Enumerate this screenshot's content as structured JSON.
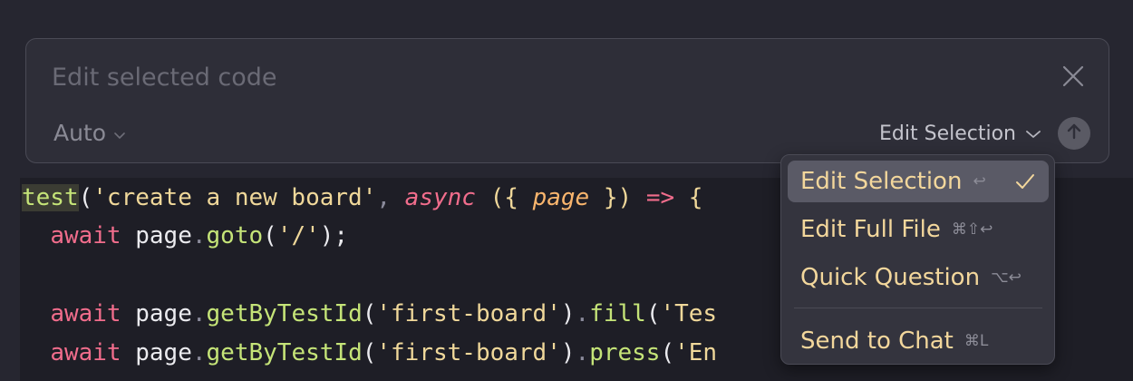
{
  "prompt": {
    "placeholder": "Edit selected code",
    "value": "",
    "model_label": "Auto",
    "mode_label": "Edit Selection"
  },
  "menu": {
    "items": [
      {
        "label": "Edit Selection",
        "shortcut": "↩",
        "selected": true
      },
      {
        "label": "Edit Full File",
        "shortcut": "⌘⇧↩",
        "selected": false
      },
      {
        "label": "Quick Question",
        "shortcut": "⌥↩",
        "selected": false
      },
      {
        "label": "Send to Chat",
        "shortcut": "⌘L",
        "selected": false
      }
    ]
  },
  "code": {
    "line1": {
      "fn": "test",
      "open": "(",
      "str": "'create a new board'",
      "comma": ", ",
      "async": "async",
      "sp": " ",
      "paren_open": "({ ",
      "param": "page",
      "paren_close": " })",
      "arrow": " => ",
      "brace": "{"
    },
    "line2": {
      "kw": "await",
      "obj": " page",
      "dot": ".",
      "method": "goto",
      "open": "(",
      "str": "'/'",
      "close": ");"
    },
    "line4": {
      "kw": "await",
      "obj": " page",
      "dot": ".",
      "method": "getByTestId",
      "open": "(",
      "str": "'first-board'",
      "close": ")",
      "dot2": ".",
      "method2": "fill",
      "open2": "(",
      "str2": "'Tes"
    },
    "line5": {
      "kw": "await",
      "obj": " page",
      "dot": ".",
      "method": "getByTestId",
      "open": "(",
      "str": "'first-board'",
      "close": ")",
      "dot2": ".",
      "method2": "press",
      "open2": "(",
      "str2": "'En"
    }
  },
  "colors": {
    "accent_menu_text": "#f3d79c",
    "selected_item_bg": "#5a5a66",
    "background": "#262630",
    "editor_bg": "#1e1e26"
  }
}
